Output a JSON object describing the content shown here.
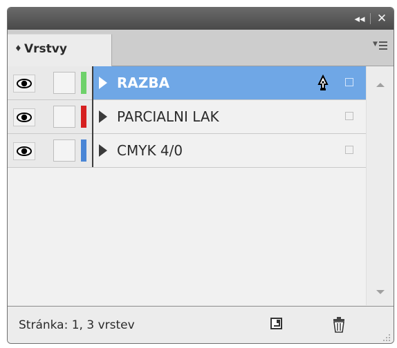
{
  "panel": {
    "tab_arrows": "♦",
    "tab_label": "Vrstvy",
    "title_buttons": {
      "collapse": "◂◂",
      "close": "✕"
    }
  },
  "layers": [
    {
      "name": "RAZBA",
      "color": "#6ed16a",
      "selected": true
    },
    {
      "name": "PARCIALNI LAK",
      "color": "#d62020",
      "selected": false
    },
    {
      "name": "CMYK 4/0",
      "color": "#4a86d6",
      "selected": false
    }
  ],
  "status": {
    "text": "Stránka: 1, 3 vrstev"
  },
  "icons": {
    "visibility": "eye-icon",
    "lock": "lock-toggle",
    "expand": "triangle-expand-icon",
    "pen": "pen-tool-icon",
    "menu": "panel-menu-icon",
    "new_layer": "new-layer-icon",
    "delete": "trash-icon"
  }
}
